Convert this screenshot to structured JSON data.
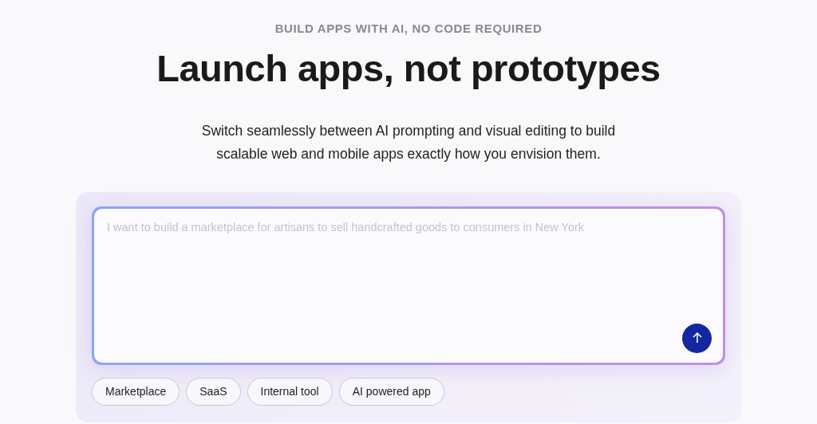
{
  "eyebrow": "BUILD APPS WITH AI, NO CODE REQUIRED",
  "headline": "Launch apps, not prototypes",
  "subtitle": "Switch seamlessly between AI prompting and visual editing to build scalable web and mobile apps exactly how you envision them.",
  "prompt": {
    "placeholder": "I want to build a marketplace for artisans to sell handcrafted goods to consumers in New York"
  },
  "suggestions": [
    "Marketplace",
    "SaaS",
    "Internal tool",
    "AI powered app"
  ]
}
